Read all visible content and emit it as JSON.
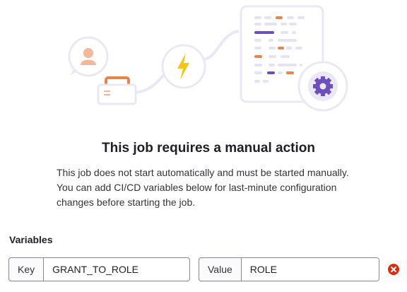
{
  "dialog": {
    "title": "This job requires a manual action",
    "description": "This job does not start automatically and must be started manually. You can add CI/CD variables below for last-minute configuration changes before starting the job."
  },
  "variables": {
    "heading": "Variables",
    "rows": [
      {
        "key_label": "Key",
        "key_value": "GRANT_TO_ROLE",
        "value_label": "Value",
        "value_value": "ROLE"
      }
    ]
  },
  "icons": {
    "illustration": "manual-job-empty-state-illustration",
    "remove": "remove-variable-icon"
  },
  "colors": {
    "accent_purple": "#6b4fbb",
    "accent_orange": "#e9834a",
    "accent_yellow": "#f5c518",
    "danger": "#dd2b0e"
  }
}
